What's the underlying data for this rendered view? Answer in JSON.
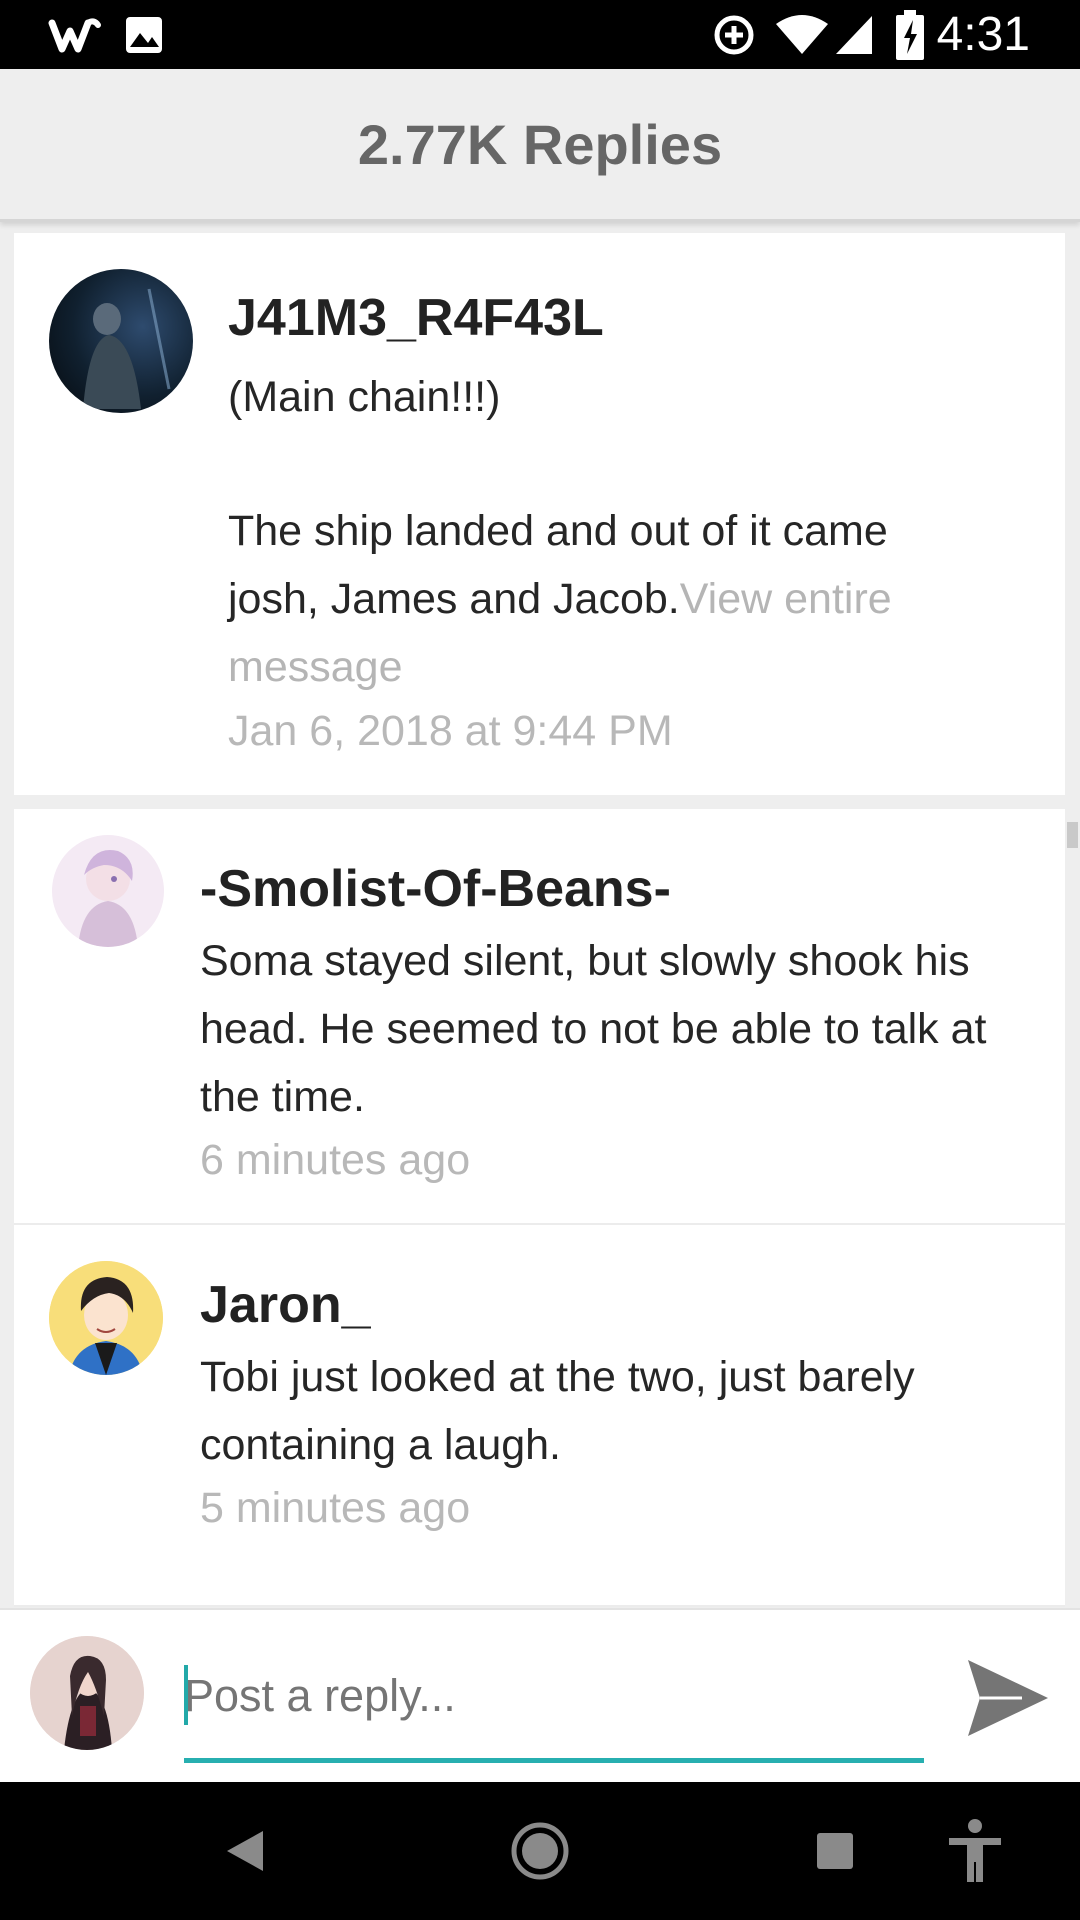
{
  "status_bar": {
    "time": "4:31",
    "icons_left": [
      "wish-app-icon",
      "image-icon"
    ],
    "icons_right": [
      "data-saver-icon",
      "wifi-icon",
      "cell-signal-icon",
      "battery-charging-icon"
    ]
  },
  "header": {
    "title": "2.77K Replies"
  },
  "main_post": {
    "username": "J41M3_R4F43L",
    "line1": "(Main chain!!!)",
    "body": "The ship landed and out of it came\njosh, James and Jacob.",
    "more_link": "View entire message",
    "timestamp": "Jan 6, 2018 at 9:44 PM"
  },
  "replies": [
    {
      "username": "-Smolist-Of-Beans-",
      "text": "Soma stayed silent, but slowly shook his\nhead. He seemed to not be able to talk at\nthe time.",
      "timestamp": "6 minutes ago"
    },
    {
      "username": "Jaron_",
      "text": "Tobi just looked at the two, just barely\ncontaining a laugh.",
      "timestamp": "5 minutes ago"
    }
  ],
  "reply_bar": {
    "placeholder": "Post a reply..."
  },
  "nav_bar": {
    "buttons": [
      "back-icon",
      "home-icon",
      "recents-icon",
      "accessibility-icon"
    ]
  },
  "colors": {
    "accent": "#27afb0",
    "header_bg": "#eeeeee",
    "timestamp": "#b8b8b8"
  }
}
